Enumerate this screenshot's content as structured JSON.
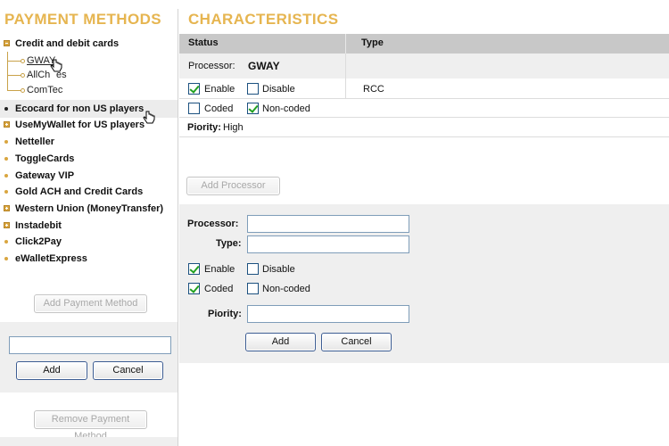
{
  "left": {
    "heading": "PAYMENT METHODS",
    "expanded_group": "Credit and debit cards",
    "sub_items": [
      "GWAY",
      "AllCharges",
      "ComTec"
    ],
    "sub_items_display": [
      "GWAY",
      "AllCh",
      "es",
      "ComTec"
    ],
    "methods": [
      {
        "label": "Ecocard for non US players",
        "marker": "dot-black",
        "selected": true
      },
      {
        "label": "UseMyWallet for US players",
        "marker": "plus"
      },
      {
        "label": "Netteller",
        "marker": "dot"
      },
      {
        "label": "ToggleCards",
        "marker": "dot"
      },
      {
        "label": "Gateway VIP",
        "marker": "dot"
      },
      {
        "label": "Gold ACH and Credit Cards",
        "marker": "dot"
      },
      {
        "label": "Western Union (MoneyTransfer)",
        "marker": "plus"
      },
      {
        "label": "Instadebit",
        "marker": "plus"
      },
      {
        "label": "Click2Pay",
        "marker": "dot"
      },
      {
        "label": "eWalletExpress",
        "marker": "dot"
      }
    ],
    "add_payment_method": "Add Payment Method",
    "new_method_value": "",
    "add": "Add",
    "cancel": "Cancel",
    "remove_payment_method": "Remove Payment Method"
  },
  "right": {
    "heading": "CHARACTERISTICS",
    "col_status": "Status",
    "col_type": "Type",
    "processor_label": "Processor:",
    "processor_value": "GWAY",
    "enable": "Enable",
    "disable": "Disable",
    "type_value": "RCC",
    "coded": "Coded",
    "non_coded": "Non-coded",
    "priority_label": "Piority:",
    "priority_value": "High",
    "add_processor": "Add Processor",
    "form": {
      "processor_label": "Processor:",
      "type_label": "Type:",
      "enable": "Enable",
      "disable": "Disable",
      "coded": "Coded",
      "non_coded": "Non-coded",
      "priority_label": "Piority:",
      "processor_value": "",
      "type_value": "",
      "priority_value": "",
      "add": "Add",
      "cancel": "Cancel"
    },
    "status": {
      "enable_checked": true,
      "disable_checked": false,
      "coded_checked": false,
      "non_coded_checked": true
    },
    "form_status": {
      "enable_checked": true,
      "disable_checked": false,
      "coded_checked": true,
      "non_coded_checked": false
    }
  },
  "colors": {
    "accent": "#e6b550",
    "header_gray": "#c8c8c8",
    "panel_gray": "#efefef"
  }
}
